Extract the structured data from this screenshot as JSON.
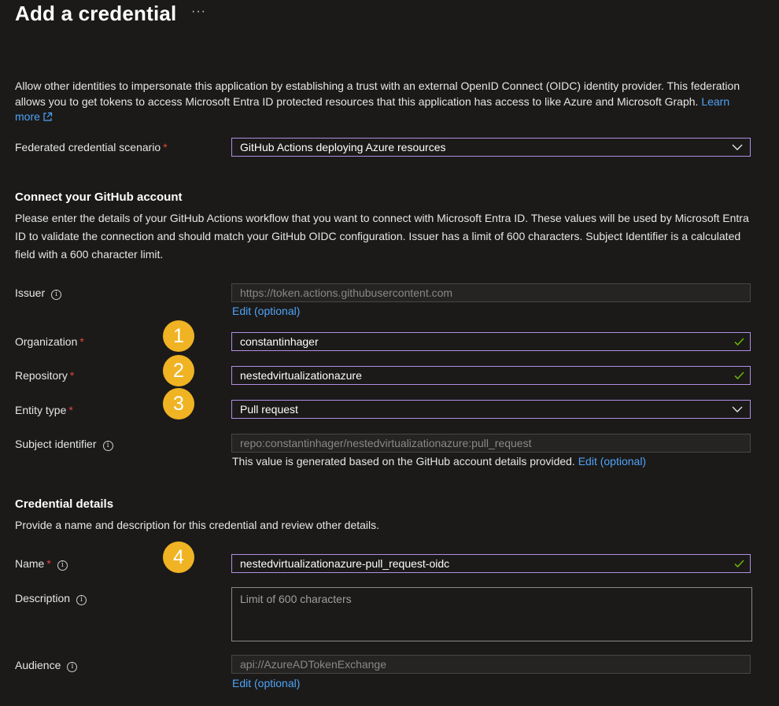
{
  "header": {
    "title": "Add a credential",
    "more": "···"
  },
  "intro": {
    "text": "Allow other identities to impersonate this application by establishing a trust with an external OpenID Connect (OIDC) identity provider. This federation allows you to get tokens to access Microsoft Entra ID protected resources that this application has access to like Azure and Microsoft Graph.",
    "learn_more": "Learn more"
  },
  "scenario": {
    "label": "Federated credential scenario",
    "value": "GitHub Actions deploying Azure resources"
  },
  "github": {
    "heading": "Connect your GitHub account",
    "description": "Please enter the details of your GitHub Actions workflow that you want to connect with Microsoft Entra ID. These values will be used by Microsoft Entra ID to validate the connection and should match your GitHub OIDC configuration. Issuer has a limit of 600 characters. Subject Identifier is a calculated field with a 600 character limit.",
    "issuer": {
      "label": "Issuer",
      "value": "https://token.actions.githubusercontent.com",
      "edit": "Edit (optional)"
    },
    "organization": {
      "label": "Organization",
      "value": "constantinhager",
      "badge": "1"
    },
    "repository": {
      "label": "Repository",
      "value": "nestedvirtualizationazure",
      "badge": "2"
    },
    "entity_type": {
      "label": "Entity type",
      "value": "Pull request",
      "badge": "3"
    },
    "subject": {
      "label": "Subject identifier",
      "value": "repo:constantinhager/nestedvirtualizationazure:pull_request",
      "note": "This value is generated based on the GitHub account details provided.",
      "edit": "Edit (optional)"
    }
  },
  "credential": {
    "heading": "Credential details",
    "description": "Provide a name and description for this credential and review other details.",
    "name": {
      "label": "Name",
      "value": "nestedvirtualizationazure-pull_request-oidc",
      "badge": "4"
    },
    "description_field": {
      "label": "Description",
      "placeholder": "Limit of 600 characters"
    },
    "audience": {
      "label": "Audience",
      "value": "api://AzureADTokenExchange",
      "edit": "Edit (optional)"
    }
  },
  "colors": {
    "accent_border": "#b38ee3",
    "link": "#4fa3f7",
    "badge": "#f0b323",
    "required": "#e3473a",
    "valid": "#6bb700"
  },
  "icons": {
    "dropdown": "chevron-down-icon",
    "valid": "checkmark-icon",
    "info": "info-icon",
    "external": "external-link-icon"
  }
}
